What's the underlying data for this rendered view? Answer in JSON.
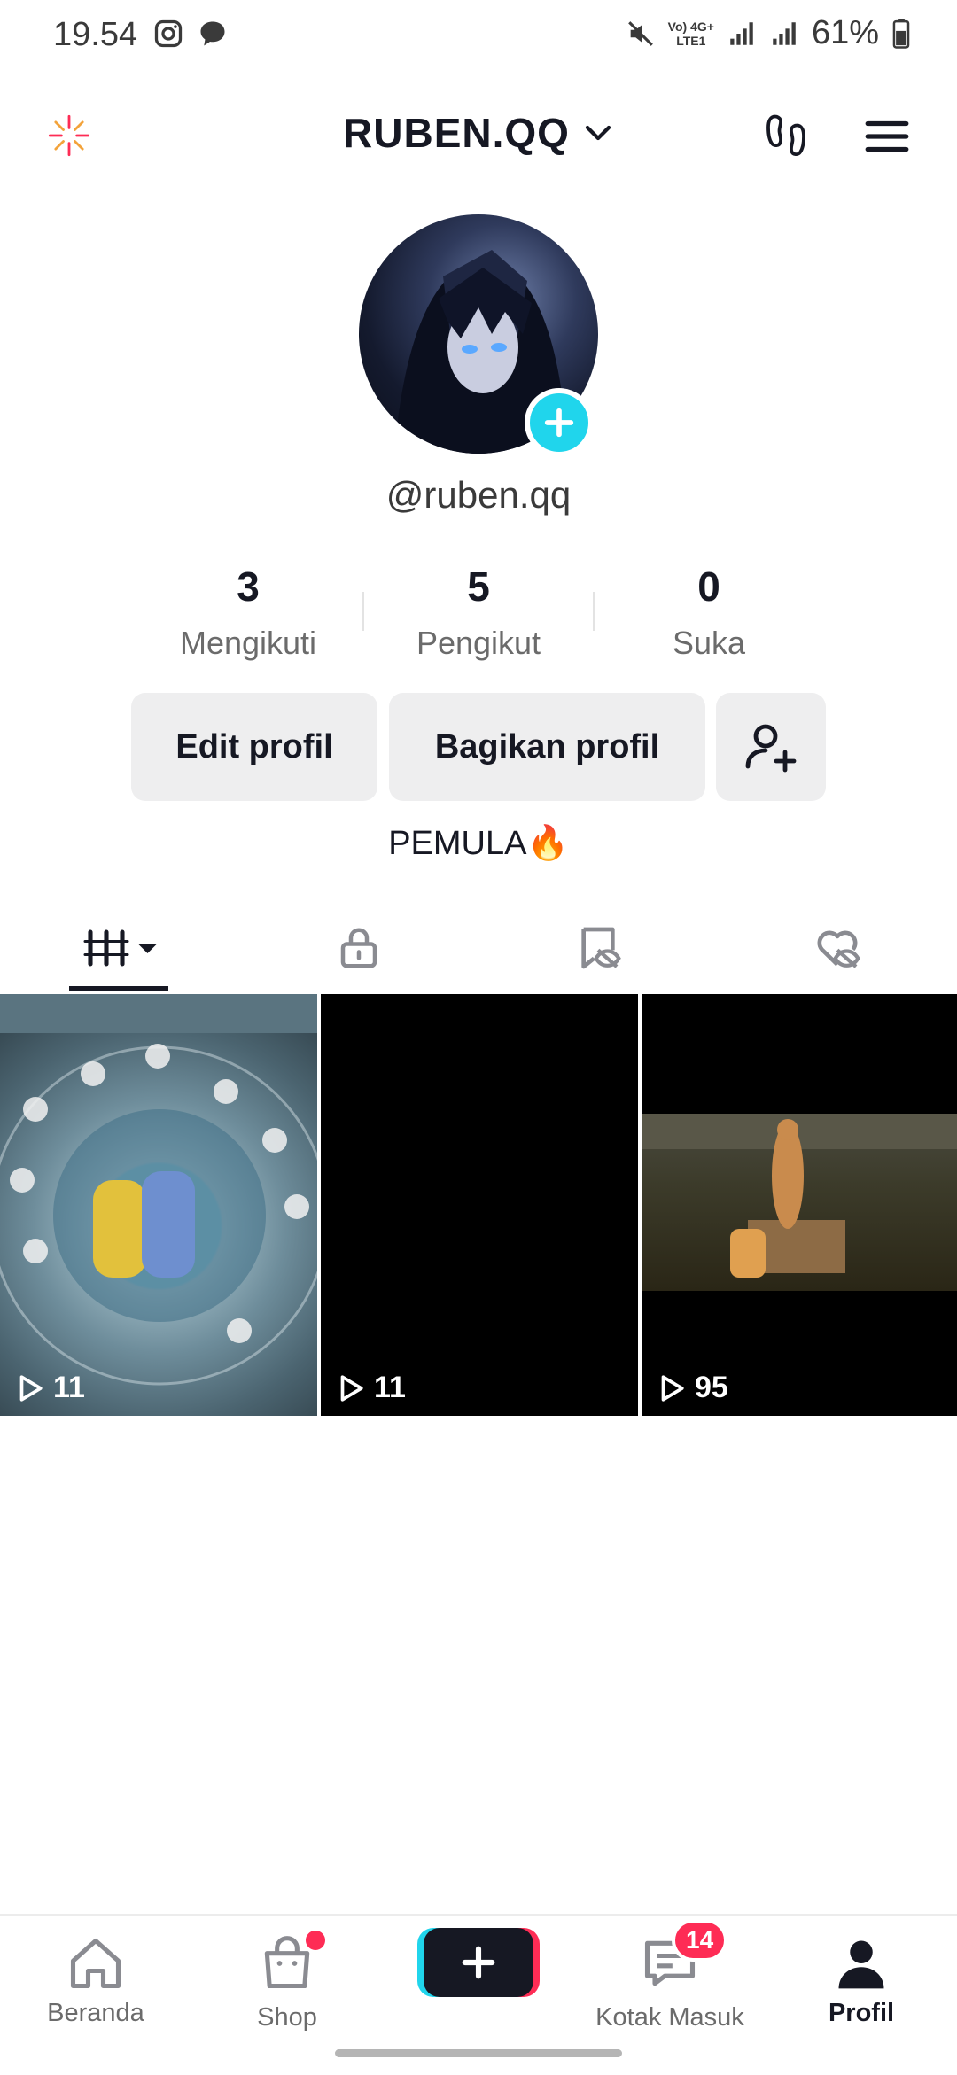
{
  "status_bar": {
    "time": "19.54",
    "network_top": "Vo) 4G+",
    "network_bottom": "LTE1",
    "battery": "61%"
  },
  "header": {
    "username": "RUBEN.QQ"
  },
  "profile": {
    "handle": "@ruben.qq",
    "bio": "PEMULA🔥",
    "stats": [
      {
        "value": "3",
        "label": "Mengikuti"
      },
      {
        "value": "5",
        "label": "Pengikut"
      },
      {
        "value": "0",
        "label": "Suka"
      }
    ]
  },
  "actions": {
    "edit": "Edit profil",
    "share": "Bagikan profil"
  },
  "videos": [
    {
      "views": "11"
    },
    {
      "views": "11"
    },
    {
      "views": "95"
    }
  ],
  "nav": {
    "home": "Beranda",
    "shop": "Shop",
    "inbox": "Kotak Masuk",
    "inbox_badge": "14",
    "profile": "Profil"
  },
  "colors": {
    "accent_cyan": "#20d5ec",
    "accent_red": "#fe2c55",
    "text_primary": "#161823"
  }
}
